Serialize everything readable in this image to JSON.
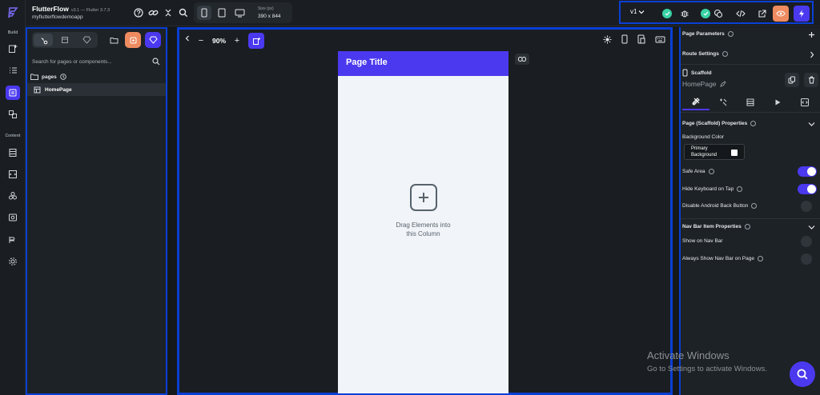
{
  "app": {
    "name": "FlutterFlow",
    "version": "v3.1 — Flutter 3.7.3",
    "project": "myflutterflowdemoapp"
  },
  "rail": {
    "build_label": "Build",
    "content_label": "Content",
    "icons": [
      "add-page-icon",
      "list-icon",
      "layers-icon",
      "widget-tree-icon",
      "table-icon",
      "code-icon",
      "teams-icon",
      "media-icon",
      "api-icon",
      "settings-icon"
    ]
  },
  "toolbar": {
    "size_label": "Size (px)",
    "size_value": "390 x 844",
    "version_select": "v1"
  },
  "left_panel": {
    "search_placeholder": "Search for pages or components...",
    "folder_label": "pages",
    "page_item": "HomePage"
  },
  "canvas": {
    "zoom": "90%",
    "page_title": "Page Title",
    "drop_line1": "Drag Elements into",
    "drop_line2": "this Column"
  },
  "right_panel": {
    "page_parameters": "Page Parameters",
    "route_settings": "Route Settings",
    "widget_type": "Scaffold",
    "widget_name": "HomePage",
    "props_header": "Page (Scaffold) Properties",
    "background_color_label": "Background Color",
    "background_chip_line1": "Primary",
    "background_chip_line2": "Background",
    "safe_area": "Safe Area",
    "hide_keyboard": "Hide Keyboard on Tap",
    "disable_back": "Disable Android Back Button",
    "nav_header": "Nav Bar Item Properties",
    "show_on_nav": "Show on Nav Bar",
    "always_show_nav": "Always Show Nav Bar on Page",
    "toggles": {
      "safe_area": true,
      "hide_keyboard": true,
      "disable_back": false,
      "show_on_nav": false,
      "always_show_nav": false
    }
  },
  "watermark": {
    "line1": "Activate Windows",
    "line2": "Go to Settings to activate Windows."
  },
  "colors": {
    "primary": "#4b39ef",
    "secondary": "#ee8b60",
    "success": "#39d2a5",
    "highlight_border": "#0a3fd6"
  }
}
